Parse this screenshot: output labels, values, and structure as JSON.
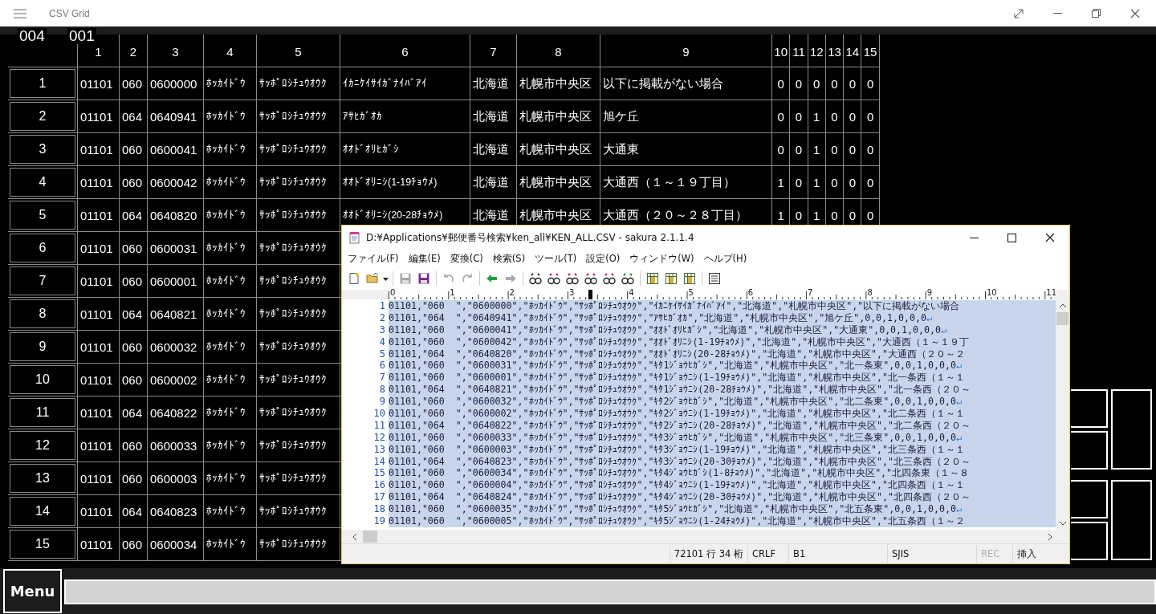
{
  "window": {
    "title": "CSV Grid"
  },
  "grid": {
    "position": {
      "row": "004",
      "column": "001"
    },
    "columns": [
      "1",
      "2",
      "3",
      "4",
      "5",
      "6",
      "7",
      "8",
      "9",
      "10",
      "11",
      "12",
      "13",
      "14",
      "15"
    ],
    "rows": [
      {
        "header": "1",
        "cells": [
          "01101",
          "060",
          "0600000",
          "ﾎｯｶｲﾄﾞｳ",
          "ｻｯﾎﾟﾛｼﾁｭｳｵｳｸ",
          "ｲｶﾆｹｲｻｲｶﾞﾅｲﾊﾞｱｲ",
          "北海道",
          "札幌市中央区",
          "以下に掲載がない場合",
          "0",
          "0",
          "0",
          "0",
          "0",
          "0"
        ]
      },
      {
        "header": "2",
        "cells": [
          "01101",
          "064",
          "0640941",
          "ﾎｯｶｲﾄﾞｳ",
          "ｻｯﾎﾟﾛｼﾁｭｳｵｳｸ",
          "ｱｻﾋｶﾞｵｶ",
          "北海道",
          "札幌市中央区",
          "旭ケ丘",
          "0",
          "0",
          "1",
          "0",
          "0",
          "0"
        ]
      },
      {
        "header": "3",
        "cells": [
          "01101",
          "060",
          "0600041",
          "ﾎｯｶｲﾄﾞｳ",
          "ｻｯﾎﾟﾛｼﾁｭｳｵｳｸ",
          "ｵｵﾄﾞｵﾘﾋｶﾞｼ",
          "北海道",
          "札幌市中央区",
          "大通東",
          "0",
          "0",
          "1",
          "0",
          "0",
          "0"
        ]
      },
      {
        "header": "4",
        "cells": [
          "01101",
          "060",
          "0600042",
          "ﾎｯｶｲﾄﾞｳ",
          "ｻｯﾎﾟﾛｼﾁｭｳｵｳｸ",
          "ｵｵﾄﾞｵﾘﾆｼ(1-19ﾁｮｳﾒ)",
          "北海道",
          "札幌市中央区",
          "大通西（１～１９丁目）",
          "1",
          "0",
          "1",
          "0",
          "0",
          "0"
        ]
      },
      {
        "header": "5",
        "cells": [
          "01101",
          "064",
          "0640820",
          "ﾎｯｶｲﾄﾞｳ",
          "ｻｯﾎﾟﾛｼﾁｭｳｵｳｸ",
          "ｵｵﾄﾞｵﾘﾆｼ(20-28ﾁｮｳﾒ)",
          "北海道",
          "札幌市中央区",
          "大通西（２０～２８丁目）",
          "1",
          "0",
          "1",
          "0",
          "0",
          "0"
        ]
      },
      {
        "header": "6",
        "cells": [
          "01101",
          "060",
          "0600031",
          "ﾎｯｶｲﾄﾞｳ",
          "ｻｯﾎﾟﾛｼﾁｭｳｵｳｸ"
        ]
      },
      {
        "header": "7",
        "cells": [
          "01101",
          "060",
          "0600001",
          "ﾎｯｶｲﾄﾞｳ",
          "ｻｯﾎﾟﾛｼﾁｭｳｵｳｸ"
        ]
      },
      {
        "header": "8",
        "cells": [
          "01101",
          "064",
          "0640821",
          "ﾎｯｶｲﾄﾞｳ",
          "ｻｯﾎﾟﾛｼﾁｭｳｵｳｸ"
        ]
      },
      {
        "header": "9",
        "cells": [
          "01101",
          "060",
          "0600032",
          "ﾎｯｶｲﾄﾞｳ",
          "ｻｯﾎﾟﾛｼﾁｭｳｵｳｸ"
        ]
      },
      {
        "header": "10",
        "cells": [
          "01101",
          "060",
          "0600002",
          "ﾎｯｶｲﾄﾞｳ",
          "ｻｯﾎﾟﾛｼﾁｭｳｵｳｸ"
        ]
      },
      {
        "header": "11",
        "cells": [
          "01101",
          "064",
          "0640822",
          "ﾎｯｶｲﾄﾞｳ",
          "ｻｯﾎﾟﾛｼﾁｭｳｵｳｸ"
        ]
      },
      {
        "header": "12",
        "cells": [
          "01101",
          "060",
          "0600033",
          "ﾎｯｶｲﾄﾞｳ",
          "ｻｯﾎﾟﾛｼﾁｭｳｵｳｸ"
        ]
      },
      {
        "header": "13",
        "cells": [
          "01101",
          "060",
          "0600003",
          "ﾎｯｶｲﾄﾞｳ",
          "ｻｯﾎﾟﾛｼﾁｭｳｵｳｸ"
        ]
      },
      {
        "header": "14",
        "cells": [
          "01101",
          "064",
          "0640823",
          "ﾎｯｶｲﾄﾞｳ",
          "ｻｯﾎﾟﾛｼﾁｭｳｵｳｸ"
        ]
      },
      {
        "header": "15",
        "cells": [
          "01101",
          "060",
          "0600034",
          "ﾎｯｶｲﾄﾞｳ",
          "ｻｯﾎﾟﾛｼﾁｭｳｵｳｸ"
        ]
      }
    ]
  },
  "editor": {
    "title": "D:¥Applications¥郵便番号検索¥ken_all¥KEN_ALL.CSV - sakura 2.1.1.4",
    "menu": [
      "ファイル(F)",
      "編集(E)",
      "変換(C)",
      "検索(S)",
      "ツール(T)",
      "設定(O)",
      "ウィンドウ(W)",
      "ヘルプ(H)"
    ],
    "toolbar": [
      {
        "disabled": false
      },
      {
        "disabled": false
      },
      {
        "disabled": false
      },
      {
        "disabled": true
      },
      {
        "disabled": false
      },
      {
        "disabled": true
      },
      {
        "disabled": true
      },
      {
        "disabled": false
      },
      {
        "disabled": true
      },
      {
        "disabled": false
      },
      {
        "disabled": false
      },
      {
        "disabled": false
      },
      {
        "disabled": false
      },
      {
        "disabled": false
      },
      {
        "disabled": false
      },
      {
        "disabled": false
      },
      {
        "disabled": false
      },
      {
        "disabled": false
      },
      {
        "disabled": false
      }
    ],
    "ruler": [
      "0",
      "1",
      "2",
      "3",
      "4",
      "5",
      "6",
      "7",
      "8",
      "9",
      "10",
      "11"
    ],
    "text_selected": true,
    "lines": [
      {
        "number": "1",
        "text": "01101,\"060  \",\"0600000\",\"ﾎｯｶｲﾄﾞｳ\",\"ｻｯﾎﾟﾛｼﾁｭｳｵｳｸ\",\"ｲｶﾆｹｲｻｲｶﾞﾅｲﾊﾞｱｲ\",\"北海道\",\"札幌市中央区\",\"以下に掲載がない場合"
      },
      {
        "number": "2",
        "text": "01101,\"064  \",\"0640941\",\"ﾎｯｶｲﾄﾞｳ\",\"ｻｯﾎﾟﾛｼﾁｭｳｵｳｸ\",\"ｱｻﾋｶﾞｵｶ\",\"北海道\",\"札幌市中央区\",\"旭ケ丘\",0,0,1,0,0,0",
        "eol": "↵"
      },
      {
        "number": "3",
        "text": "01101,\"060  \",\"0600041\",\"ﾎｯｶｲﾄﾞｳ\",\"ｻｯﾎﾟﾛｼﾁｭｳｵｳｸ\",\"ｵｵﾄﾞｵﾘﾋｶﾞｼ\",\"北海道\",\"札幌市中央区\",\"大通東\",0,0,1,0,0,0",
        "eol": "↵"
      },
      {
        "number": "4",
        "text": "01101,\"060  \",\"0600042\",\"ﾎｯｶｲﾄﾞｳ\",\"ｻｯﾎﾟﾛｼﾁｭｳｵｳｸ\",\"ｵｵﾄﾞｵﾘﾆｼ(1-19ﾁｮｳﾒ)\",\"北海道\",\"札幌市中央区\",\"大通西（１～１９丁"
      },
      {
        "number": "5",
        "text": "01101,\"064  \",\"0640820\",\"ﾎｯｶｲﾄﾞｳ\",\"ｻｯﾎﾟﾛｼﾁｭｳｵｳｸ\",\"ｵｵﾄﾞｵﾘﾆｼ(20-28ﾁｮｳﾒ)\",\"北海道\",\"札幌市中央区\",\"大通西（２０～２"
      },
      {
        "number": "6",
        "text": "01101,\"060  \",\"0600031\",\"ﾎｯｶｲﾄﾞｳ\",\"ｻｯﾎﾟﾛｼﾁｭｳｵｳｸ\",\"ｷﾀ1ｼﾞｮｳﾋｶﾞｼ\",\"北海道\",\"札幌市中央区\",\"北一条東\",0,0,1,0,0,0",
        "eol": "↵"
      },
      {
        "number": "7",
        "text": "01101,\"060  \",\"0600001\",\"ﾎｯｶｲﾄﾞｳ\",\"ｻｯﾎﾟﾛｼﾁｭｳｵｳｸ\",\"ｷﾀ1ｼﾞｮｳﾆｼ(1-19ﾁｮｳﾒ)\",\"北海道\",\"札幌市中央区\",\"北一条西（１～１"
      },
      {
        "number": "8",
        "text": "01101,\"064  \",\"0640821\",\"ﾎｯｶｲﾄﾞｳ\",\"ｻｯﾎﾟﾛｼﾁｭｳｵｳｸ\",\"ｷﾀ1ｼﾞｮｳﾆｼ(20-28ﾁｮｳﾒ)\",\"北海道\",\"札幌市中央区\",\"北一条西（２０～"
      },
      {
        "number": "9",
        "text": "01101,\"060  \",\"0600032\",\"ﾎｯｶｲﾄﾞｳ\",\"ｻｯﾎﾟﾛｼﾁｭｳｵｳｸ\",\"ｷﾀ2ｼﾞｮｳﾋｶﾞｼ\",\"北海道\",\"札幌市中央区\",\"北二条東\",0,0,1,0,0,0",
        "eol": "↵"
      },
      {
        "number": "10",
        "text": "01101,\"060  \",\"0600002\",\"ﾎｯｶｲﾄﾞｳ\",\"ｻｯﾎﾟﾛｼﾁｭｳｵｳｸ\",\"ｷﾀ2ｼﾞｮｳﾆｼ(1-19ﾁｮｳﾒ)\",\"北海道\",\"札幌市中央区\",\"北二条西（１～１"
      },
      {
        "number": "11",
        "text": "01101,\"064  \",\"0640822\",\"ﾎｯｶｲﾄﾞｳ\",\"ｻｯﾎﾟﾛｼﾁｭｳｵｳｸ\",\"ｷﾀ2ｼﾞｮｳﾆｼ(20-28ﾁｮｳﾒ)\",\"北海道\",\"札幌市中央区\",\"北二条西（２０～"
      },
      {
        "number": "12",
        "text": "01101,\"060  \",\"0600033\",\"ﾎｯｶｲﾄﾞｳ\",\"ｻｯﾎﾟﾛｼﾁｭｳｵｳｸ\",\"ｷﾀ3ｼﾞｮｳﾋｶﾞｼ\",\"北海道\",\"札幌市中央区\",\"北三条東\",0,0,1,0,0,0",
        "eol": "↵"
      },
      {
        "number": "13",
        "text": "01101,\"060  \",\"0600003\",\"ﾎｯｶｲﾄﾞｳ\",\"ｻｯﾎﾟﾛｼﾁｭｳｵｳｸ\",\"ｷﾀ3ｼﾞｮｳﾆｼ(1-19ﾁｮｳﾒ)\",\"北海道\",\"札幌市中央区\",\"北三条西（１～１"
      },
      {
        "number": "14",
        "text": "01101,\"064  \",\"0640823\",\"ﾎｯｶｲﾄﾞｳ\",\"ｻｯﾎﾟﾛｼﾁｭｳｵｳｸ\",\"ｷﾀ3ｼﾞｮｳﾆｼ(20-30ﾁｮｳﾒ)\",\"北海道\",\"札幌市中央区\",\"北三条西（２０～"
      },
      {
        "number": "15",
        "text": "01101,\"060  \",\"0600034\",\"ﾎｯｶｲﾄﾞｳ\",\"ｻｯﾎﾟﾛｼﾁｭｳｵｳｸ\",\"ｷﾀ4ｼﾞｮｳﾋｶﾞｼ(1-8ﾁｮｳﾒ)\",\"北海道\",\"札幌市中央区\",\"北四条東（１～８"
      },
      {
        "number": "16",
        "text": "01101,\"060  \",\"0600004\",\"ﾎｯｶｲﾄﾞｳ\",\"ｻｯﾎﾟﾛｼﾁｭｳｵｳｸ\",\"ｷﾀ4ｼﾞｮｳﾆｼ(1-19ﾁｮｳﾒ)\",\"北海道\",\"札幌市中央区\",\"北四条西（１～１"
      },
      {
        "number": "17",
        "text": "01101,\"064  \",\"0640824\",\"ﾎｯｶｲﾄﾞｳ\",\"ｻｯﾎﾟﾛｼﾁｭｳｵｳｸ\",\"ｷﾀ4ｼﾞｮｳﾆｼ(20-30ﾁｮｳﾒ)\",\"北海道\",\"札幌市中央区\",\"北四条西（２０～"
      },
      {
        "number": "18",
        "text": "01101,\"060  \",\"0600035\",\"ﾎｯｶｲﾄﾞｳ\",\"ｻｯﾎﾟﾛｼﾁｭｳｵｳｸ\",\"ｷﾀ5ｼﾞｮｳﾋｶﾞｼ\",\"北海道\",\"札幌市中央区\",\"北五条東\",0,0,1,0,0,0",
        "eol": "↵"
      },
      {
        "number": "19",
        "text": "01101,\"060  \",\"0600005\",\"ﾎｯｶｲﾄﾞｳ\",\"ｻｯﾎﾟﾛｼﾁｭｳｵｳｸ\",\"ｷﾀ5ｼﾞｮｳﾆｼ(1-24ﾁｮｳﾒ)\",\"北海道\",\"札幌市中央区\",\"北五条西（１～２"
      }
    ],
    "status": [
      {
        "text": "72101 行  34 桁",
        "disabled": false
      },
      {
        "text": "CRLF",
        "disabled": false
      },
      {
        "text": "B1",
        "disabled": false
      },
      {
        "text": "SJIS",
        "disabled": false
      },
      {
        "text": "REC",
        "disabled": true
      },
      {
        "text": "挿入",
        "disabled": false
      }
    ]
  },
  "bottom": {
    "menu_button": "Menu"
  }
}
